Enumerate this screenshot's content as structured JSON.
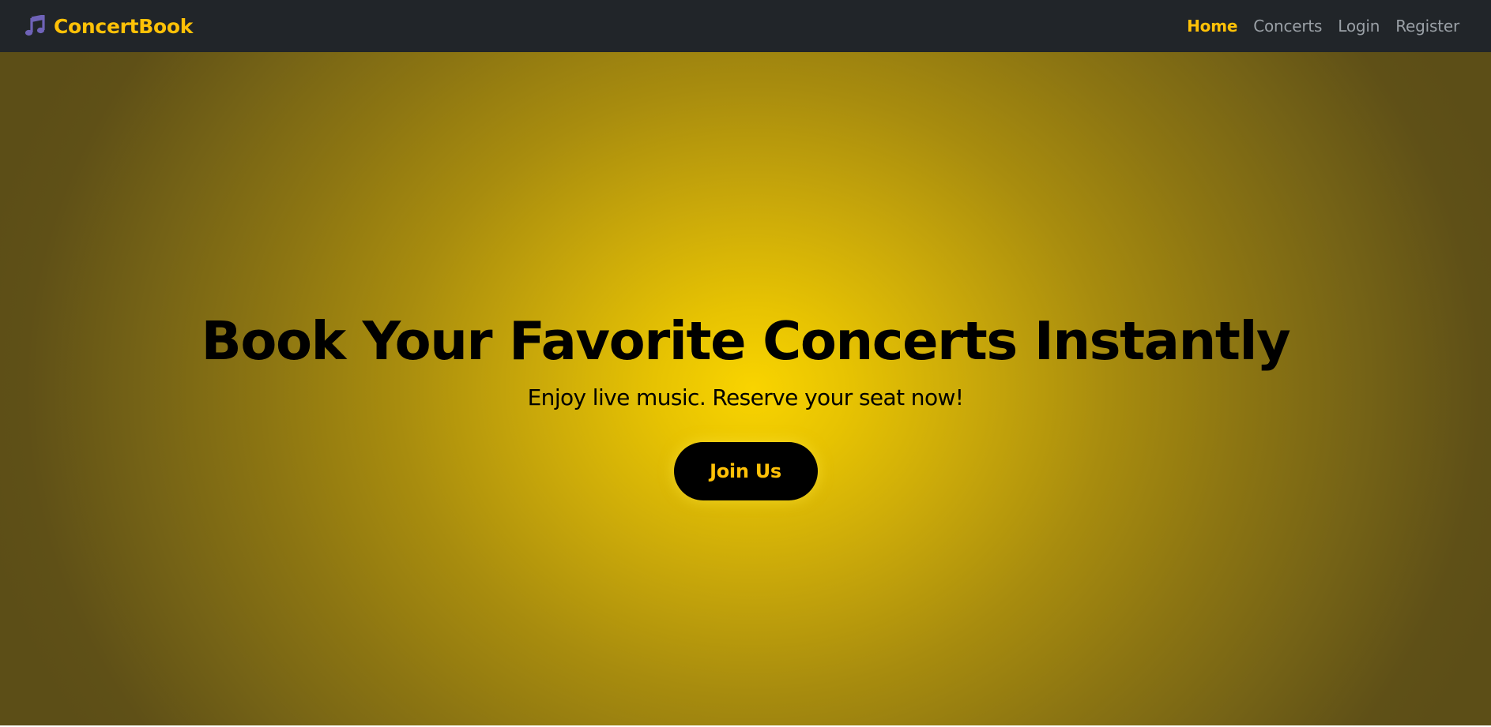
{
  "navbar": {
    "brand_icon": "music-note-icon",
    "brand_label": "ConcertBook",
    "colors": {
      "background": "#212529",
      "accent": "#ffc107",
      "link": "#9aa0a6",
      "icon": "#6f63b8"
    },
    "links": [
      {
        "label": "Home",
        "active": true
      },
      {
        "label": "Concerts",
        "active": false
      },
      {
        "label": "Login",
        "active": false
      },
      {
        "label": "Register",
        "active": false
      }
    ]
  },
  "hero": {
    "title": "Book Your Favorite Concerts Instantly",
    "subtitle": "Enjoy live music. Reserve your seat now!",
    "button_label": "Join Us",
    "colors": {
      "center": "#f9d400",
      "edge": "#5c4e17",
      "button_bg": "#000000",
      "button_text": "#ffc107"
    }
  }
}
